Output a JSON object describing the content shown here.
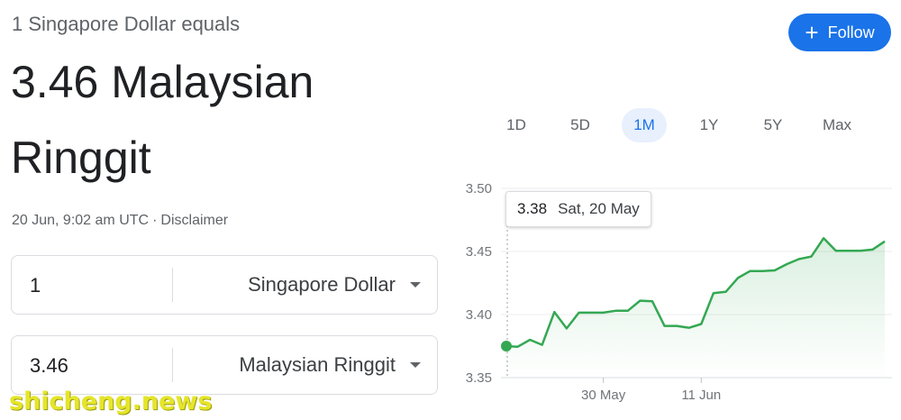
{
  "header": {
    "subtitle": "1 Singapore Dollar equals",
    "result_line1": "3.46 Malaysian",
    "result_line2": "Ringgit",
    "timestamp": "20 Jun, 9:02 am UTC",
    "separator": "·",
    "disclaimer": "Disclaimer"
  },
  "follow_button": {
    "label": "Follow",
    "icon": "plus-icon"
  },
  "converter": {
    "from": {
      "amount": "1",
      "currency": "Singapore Dollar"
    },
    "to": {
      "amount": "3.46",
      "currency": "Malaysian Ringgit"
    }
  },
  "range_tabs": [
    "1D",
    "5D",
    "1M",
    "1Y",
    "5Y",
    "Max"
  ],
  "active_tab": "1M",
  "tooltip": {
    "value": "3.38",
    "date": "Sat, 20 May"
  },
  "watermark": "shicheng.news",
  "colors": {
    "accent": "#1a73e8",
    "line": "#34a853",
    "watermark": "#e5e52a"
  },
  "chart_data": {
    "type": "line",
    "y_ticks": [
      "3.50",
      "3.45",
      "3.40",
      "3.35"
    ],
    "x_ticks": [
      {
        "label": "30 May",
        "index": 8
      },
      {
        "label": "11 Jun",
        "index": 16
      }
    ],
    "ylim": [
      3.35,
      3.5
    ],
    "values": [
      3.375,
      3.3745,
      3.38,
      3.376,
      3.402,
      3.389,
      3.4015,
      3.4015,
      3.4015,
      3.403,
      3.403,
      3.411,
      3.4105,
      3.391,
      3.391,
      3.3895,
      3.3925,
      3.417,
      3.418,
      3.429,
      3.4345,
      3.4345,
      3.435,
      3.44,
      3.444,
      3.446,
      3.4605,
      3.4505,
      3.4505,
      3.4505,
      3.4515,
      3.458
    ],
    "highlight_index": 0
  }
}
